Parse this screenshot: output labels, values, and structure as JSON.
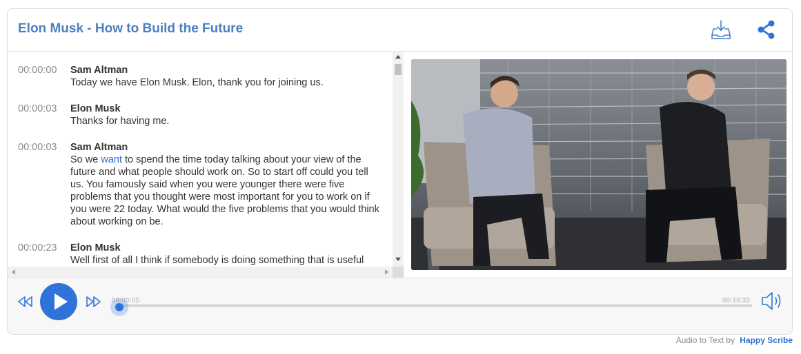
{
  "header": {
    "title": "Elon Musk - How to Build the Future",
    "download_icon": "download-tray-icon",
    "share_icon": "share-icon"
  },
  "transcript": {
    "entries": [
      {
        "time": "00:00:00",
        "speaker": "Sam Altman",
        "text": "Today we have Elon Musk. Elon, thank you for joining us."
      },
      {
        "time": "00:00:03",
        "speaker": "Elon Musk",
        "text": "Thanks for having me."
      },
      {
        "time": "00:00:03",
        "speaker": "Sam Altman",
        "text_before": "So we ",
        "highlight": "want",
        "text_after": " to spend the time today talking about your view of the future and what people should work on. So to start off could you tell us. You famously said when you were younger there were five problems that you thought were most important for you to work on if you were 22 today. What would the five problems that you would think about working on be."
      },
      {
        "time": "00:00:23",
        "speaker": "Elon Musk",
        "text": "Well first of all I think if somebody is doing something that is useful"
      }
    ]
  },
  "player": {
    "current_time": "00:00:05",
    "duration": "00:19:32",
    "progress_fraction": 0.004,
    "rewind_icon": "rewind-icon",
    "play_icon": "play-icon",
    "forward_icon": "fast-forward-icon",
    "volume_icon": "volume-icon",
    "accent_color": "#2f73d8"
  },
  "footer": {
    "label": "Audio to Text by",
    "brand": "Happy Scribe"
  }
}
